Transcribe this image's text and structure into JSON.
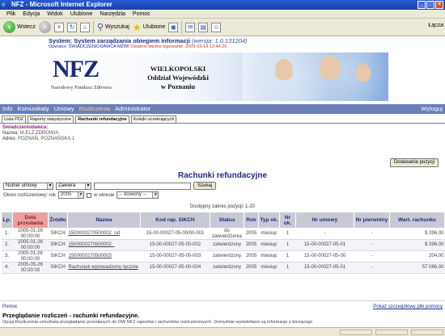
{
  "window": {
    "title": "NFZ - Microsoft Internet Explorer"
  },
  "menu": [
    "Plik",
    "Edycja",
    "Widok",
    "Ulubione",
    "Narzędzia",
    "Pomoc"
  ],
  "toolbar": {
    "back": "Wstecz",
    "search": "Wyszukaj",
    "favorites": "Ulubione",
    "address_label": "Łącza"
  },
  "system": {
    "title": "System: System zarządzania obiegiem informacji",
    "version": "(wersja: 1.0.131204)",
    "operator_label": "Operator:",
    "operator": "ŚWIADCZENIODAWCA MZWI",
    "last_login_label": "Ostatnie błędne logowanie:",
    "last_login": "2005-03-14 13:44:29"
  },
  "banner": {
    "logo": "NFZ",
    "logo_sub": "Narodowy Fundusz Zdrowia",
    "org_line1": "WIELKOPOLSKI",
    "org_line2": "Oddział Wojewódzki",
    "org_line3": "w Poznaniu"
  },
  "nav": {
    "items": [
      "Info",
      "Komunikaty",
      "Umowy",
      "Rozliczenia",
      "Administrator"
    ],
    "active": "Rozliczenia",
    "logout": "Wyloguj"
  },
  "tabs": [
    "Lista PDZ",
    "Raporty statystyczne",
    "Rachunki refundacyjne",
    "Kolejki oczekujących"
  ],
  "provider": {
    "label": "Świadczeniodawca:",
    "name_label": "Nazwa:",
    "name": "M.ELŻ.ZDROWIA",
    "address_label": "Adres:",
    "address": "POZNAŃ, POZNAŃSKA 1"
  },
  "add_button": "Dodawanie pozycji",
  "page_title": "Rachunki refundacyjne",
  "filter": {
    "field": "Numer umowy",
    "operator": "Zawiera",
    "search_button": "Szukaj",
    "year_label": "Okres rozliczeniowy: rok",
    "year": "2005",
    "month_label": "w okresie",
    "month": "-- dowolny --"
  },
  "range_text": "Dostępny zakres pozycji: 1-20",
  "table": {
    "headers": [
      "Lp.",
      "Data przesłania",
      "Źródło",
      "Nazwa",
      "Kod rap. SIKCH",
      "Status",
      "Rok",
      "Typ ok.",
      "Nr ok.",
      "Nr umowy",
      "Nr pierwotny",
      "Wart. rachunku"
    ],
    "rows": [
      [
        "1.",
        "2005-01-26 00:00:00",
        "SIKCH",
        "1500000270500002_raf",
        "15-00-00027-05-00/00-001",
        "do zatwierdzenia",
        "2005",
        "miesiąc",
        "1",
        "-",
        "-",
        "$ 396,00"
      ],
      [
        "2.",
        "2005-01-26 00:00:00",
        "SIKCH",
        "1500000270500002_",
        "15-00-00027-05-00-002",
        "zatwierdzony",
        "2005",
        "miesiąc",
        "1",
        "15-00-00027-05-01",
        "-",
        "$ 396,00"
      ],
      [
        "3.",
        "2005-01-26 00:00:00",
        "SIKCH",
        "1500000270500003",
        "15-00-00027-05-00-003",
        "zatwierdzony",
        "2005",
        "miesiąc",
        "1",
        "15-00-00027-05-00",
        "-",
        "204,00"
      ],
      [
        "4.",
        "2005-05-26 00:00:00",
        "SIKCH",
        "Rachunek wprowadzony ręcznie",
        "15-00-00027-05-00-004",
        "zatwierdzony",
        "2005",
        "miesiąc",
        "1",
        "15-00-00027-05-01",
        "-",
        "57 086,00"
      ]
    ]
  },
  "help": {
    "title": "Pomoc",
    "link": "Pokaż szczegółowy plik pomocy",
    "subtitle": "Przeglądanie rozliczeń - rachunki refundacyjne.",
    "text": "Opcja Rozliczenia umożliwia przeglądanie przesłanych do OW NFZ raportów i rachunków rozliczeniowych. Domyślnie wyświetlane są informacje z bieżącego"
  }
}
